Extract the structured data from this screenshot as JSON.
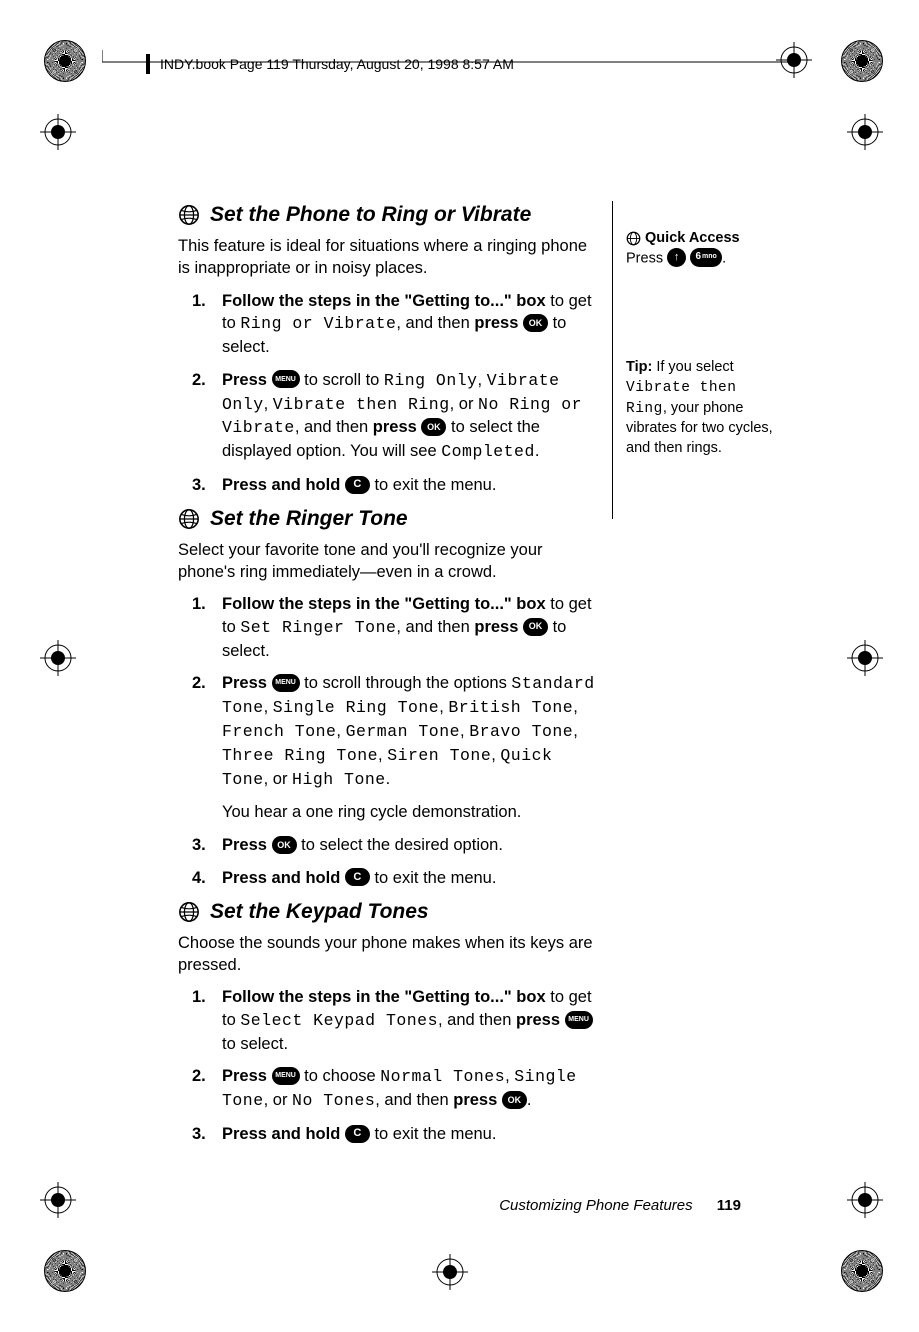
{
  "running_header": "INDY.book  Page 119  Thursday, August 20, 1998  8:57 AM",
  "sections": [
    {
      "title": "Set the Phone to Ring or Vibrate",
      "intro": "This feature is ideal for situations where a ringing phone is inappropriate or in noisy places.",
      "steps": [
        {
          "n": "1.",
          "bold1": "Follow the steps in the \"Getting to...\" box",
          "mid1": " to get to ",
          "lcd1": "Ring or Vibrate",
          "mid2": ", and then ",
          "bold2": "press ",
          "key1": "ok",
          "tail": " to select."
        },
        {
          "n": "2.",
          "bold1": "Press ",
          "key1": "menu",
          "mid1": " to scroll to ",
          "lcd1": "Ring Only",
          "mid2": ", ",
          "lcd2": "Vibrate Only",
          "mid3": ", ",
          "lcd3": "Vibrate then Ring",
          "mid4": ", or ",
          "lcd4": "No Ring or Vibrate",
          "mid5": ", and then ",
          "bold2": "press ",
          "key2": "ok",
          "mid6": " to select the displayed option. You will see ",
          "lcd5": "Completed",
          "tail": "."
        },
        {
          "n": "3.",
          "bold1": "Press and hold ",
          "key1": "c",
          "tail": " to exit the menu."
        }
      ]
    },
    {
      "title": "Set the Ringer Tone",
      "intro": "Select your favorite tone and you'll recognize your phone's ring immediately—even in a crowd.",
      "steps": [
        {
          "n": "1.",
          "bold1": "Follow the steps in the \"Getting to...\" box",
          "mid1": " to get to ",
          "lcd1": "Set Ringer Tone",
          "mid2": ", and then ",
          "bold2": "press ",
          "key1": "ok",
          "tail": " to select."
        },
        {
          "n": "2.",
          "bold1": "Press ",
          "key1": "menu",
          "mid1": " to scroll through the options ",
          "lcd1": "Standard Tone",
          "mid2": ", ",
          "lcd2": "Single Ring Tone",
          "mid3": ", ",
          "lcd3": "British Tone",
          "mid4": ", ",
          "lcd4": "French Tone",
          "mid5": ", ",
          "lcd5": "German Tone",
          "mid6": ", ",
          "lcd6": "Bravo Tone",
          "mid7": ", ",
          "lcd7": "Three Ring Tone",
          "mid8": ", ",
          "lcd8": "Siren Tone",
          "mid9": ", ",
          "lcd9": "Quick Tone",
          "mid10": ", or ",
          "lcd10": "High Tone",
          "tail": "."
        }
      ],
      "demo": "You hear a one ring cycle demonstration.",
      "steps2": [
        {
          "n": "3.",
          "bold1": "Press ",
          "key1": "ok",
          "tail": " to select the desired option."
        },
        {
          "n": "4.",
          "bold1": "Press and hold ",
          "key1": "c",
          "tail": " to exit the menu."
        }
      ]
    },
    {
      "title": "Set the Keypad Tones",
      "intro": "Choose the sounds your phone makes when its keys are pressed.",
      "steps": [
        {
          "n": "1.",
          "bold1": "Follow the steps in the \"Getting to...\" box",
          "mid1": " to get to ",
          "lcd1": "Select Keypad Tones",
          "mid2": ", and then ",
          "bold2": "press ",
          "key1": "menu",
          "tail": " to select."
        },
        {
          "n": "2.",
          "bold1": "Press ",
          "key1": "menu",
          "mid1": " to choose ",
          "lcd1": "Normal Tones",
          "mid2": ", ",
          "lcd2": "Single Tone",
          "mid3": ", or ",
          "lcd3": "No Tones",
          "mid4": ", and then ",
          "bold2": "press ",
          "key2": "ok",
          "tail": "."
        },
        {
          "n": "3.",
          "bold1": "Press and hold ",
          "key1": "c",
          "tail": " to exit the menu."
        }
      ]
    }
  ],
  "sidebar": {
    "quick_access": {
      "label": "Quick Access",
      "press": "Press ",
      "dot": "."
    },
    "tip": {
      "label": "Tip:",
      "t1": " If you select ",
      "lcd": "Vibrate then Ring",
      "t2": ", your phone vibrates for two cycles, and then rings."
    }
  },
  "footer": {
    "title": "Customizing Phone Features",
    "page": "119"
  }
}
